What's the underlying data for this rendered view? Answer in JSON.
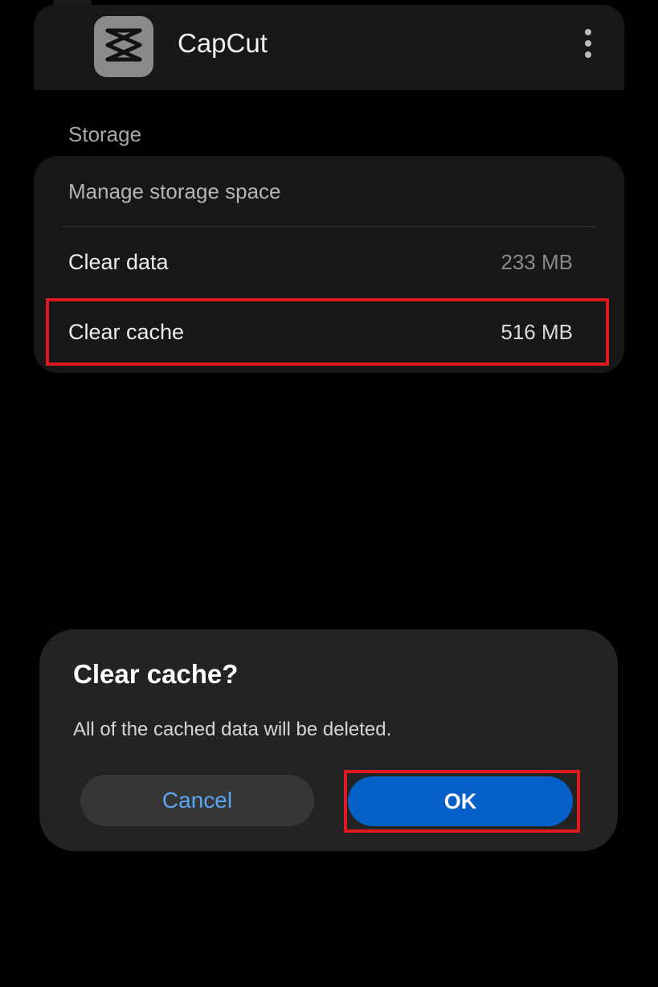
{
  "header": {
    "app_name": "CapCut",
    "app_icon": "capcut-logo-icon",
    "more_icon": "more-vertical-icon"
  },
  "storage": {
    "section_title": "Storage",
    "manage_label": "Manage storage space",
    "clear_data": {
      "label": "Clear data",
      "value": "233 MB"
    },
    "clear_cache": {
      "label": "Clear cache",
      "value": "516 MB"
    }
  },
  "dialog": {
    "title": "Clear cache?",
    "message": "All of the cached data will be deleted.",
    "cancel_label": "Cancel",
    "ok_label": "OK"
  },
  "colors": {
    "background": "#000000",
    "card": "#171717",
    "dialog": "#232323",
    "accent_blue": "#0561c8",
    "cancel_text": "#5aa6f2",
    "highlight_red": "#e0181f",
    "muted_value": "#8a8a8a"
  }
}
